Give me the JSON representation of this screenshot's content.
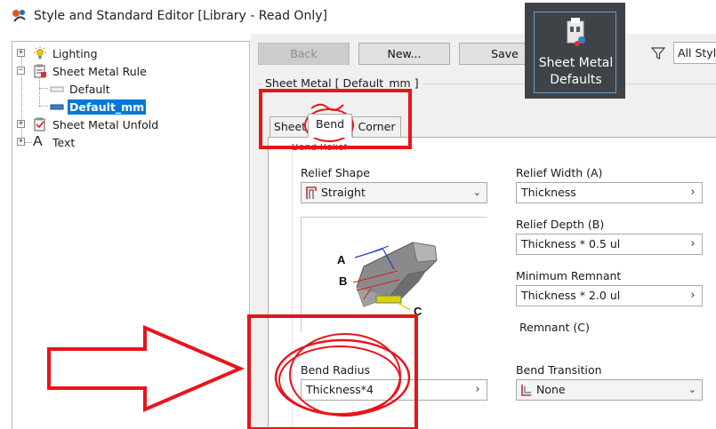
{
  "window": {
    "title": "Style and Standard Editor [Library - Read Only]"
  },
  "tree": {
    "items": [
      {
        "label": "Lighting",
        "icon": "lighting-icon"
      },
      {
        "label": "Sheet Metal Rule",
        "icon": "sheet-metal-rule-icon"
      },
      {
        "label": "Default",
        "icon": "style-swatch-icon"
      },
      {
        "label": "Default_mm",
        "icon": "style-swatch-icon",
        "selected": true
      },
      {
        "label": "Sheet Metal Unfold",
        "icon": "sheet-metal-unfold-icon"
      },
      {
        "label": "Text",
        "icon": "text-icon"
      }
    ]
  },
  "toolbar": {
    "back_label": "Back",
    "new_label": "New...",
    "save_label": "Save",
    "filter_value": "All Style"
  },
  "tooltip": {
    "line1": "Sheet Metal",
    "line2": "Defaults",
    "icon": "sheet-metal-defaults-icon"
  },
  "group": {
    "title": "Sheet Metal [ Default_mm ]"
  },
  "tabs": [
    {
      "label": "Sheet"
    },
    {
      "label": "Bend",
      "active": true
    },
    {
      "label": "Corner"
    }
  ],
  "bend": {
    "section_label": "Bend Relief",
    "relief_shape": {
      "label": "Relief Shape",
      "value": "Straight"
    },
    "relief_width": {
      "label": "Relief Width (A)",
      "value": "Thickness"
    },
    "relief_depth": {
      "label": "Relief Depth (B)",
      "value": "Thickness * 0.5 ul"
    },
    "minimum_remnant": {
      "label": "Minimum Remnant",
      "value": "Thickness * 2.0 ul"
    },
    "remnant_label": "Remnant (C)",
    "bend_radius": {
      "label": "Bend Radius",
      "value": "Thickness*4"
    },
    "bend_transition": {
      "label": "Bend Transition",
      "value": "None"
    },
    "preview_labels": {
      "a": "A",
      "b": "B",
      "c": "C"
    }
  },
  "colors": {
    "selection": "#0078d7",
    "annotation": "#e8141b",
    "tooltip_bg": "#3f4347"
  }
}
